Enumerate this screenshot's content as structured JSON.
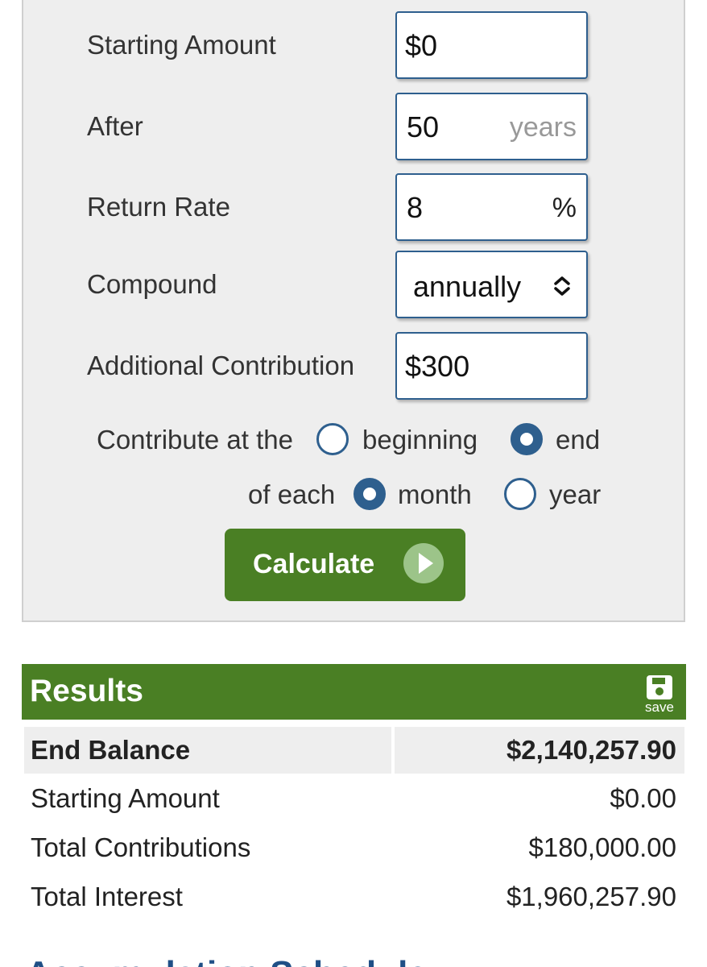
{
  "form": {
    "starting_amount": {
      "label": "Starting Amount",
      "value": "$0"
    },
    "after": {
      "label": "After",
      "value": "50",
      "unit": "years"
    },
    "return_rate": {
      "label": "Return Rate",
      "value": "8",
      "unit": "%"
    },
    "compound": {
      "label": "Compound",
      "selected": "annually"
    },
    "additional_contribution": {
      "label": "Additional Contribution",
      "value": "$300"
    },
    "contribute_timing": {
      "prefix": "Contribute at the",
      "options": [
        "beginning",
        "end"
      ],
      "selected": "end"
    },
    "contribute_frequency": {
      "prefix": "of each",
      "options": [
        "month",
        "year"
      ],
      "selected": "month"
    },
    "calculate_label": "Calculate"
  },
  "results": {
    "title": "Results",
    "save_label": "save",
    "rows": [
      {
        "label": "End Balance",
        "value": "$2,140,257.90"
      },
      {
        "label": "Starting Amount",
        "value": "$0.00"
      },
      {
        "label": "Total Contributions",
        "value": "$180,000.00"
      },
      {
        "label": "Total Interest",
        "value": "$1,960,257.90"
      }
    ]
  },
  "next_section": {
    "title": "Accumulation Schedule"
  },
  "colors": {
    "accent_green": "#4a7f24",
    "accent_blue": "#2e5f8e",
    "panel_bg": "#eeeeee"
  }
}
